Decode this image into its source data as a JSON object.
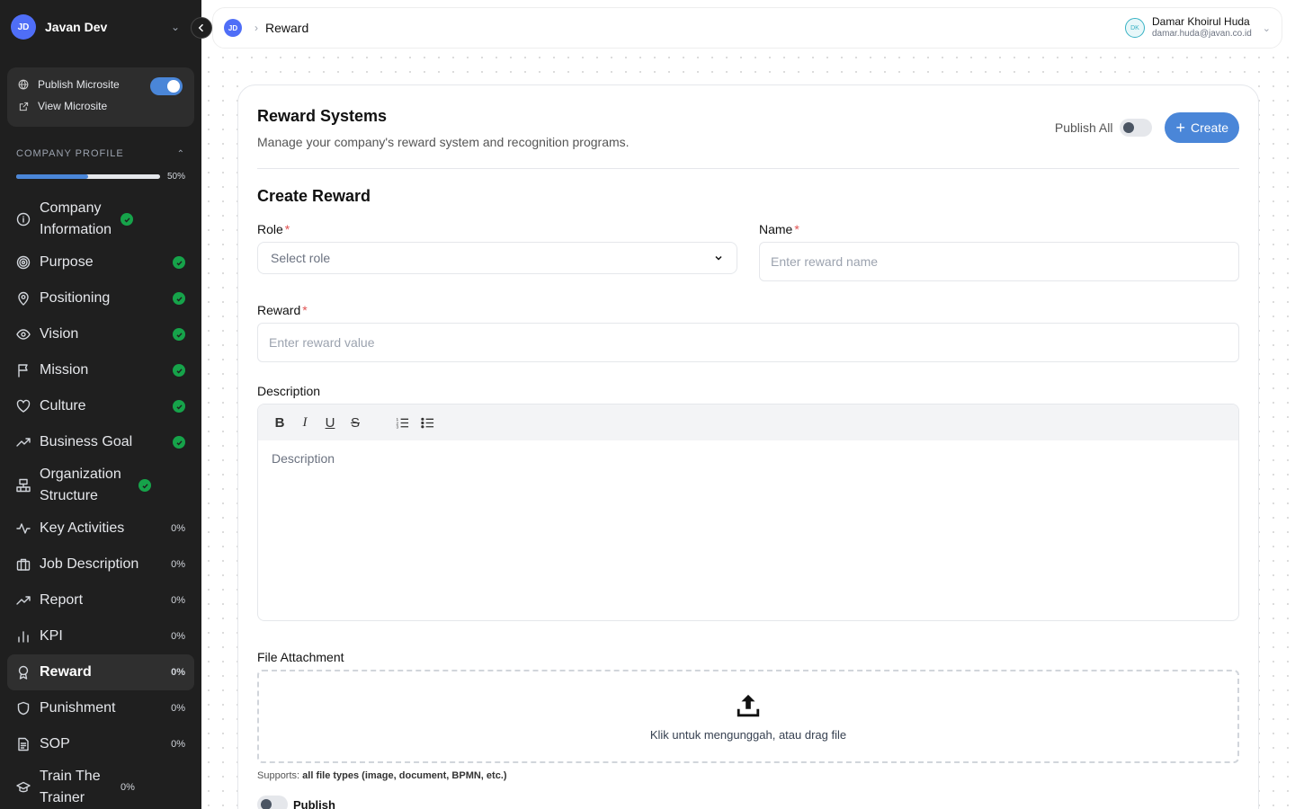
{
  "workspace": {
    "initials": "JD",
    "name": "Javan Dev"
  },
  "microsite": {
    "publish_label": "Publish Microsite",
    "view_label": "View Microsite",
    "published": true
  },
  "company_profile": {
    "heading": "COMPANY PROFILE",
    "progress_percent": 50,
    "progress_label": "50%",
    "items": [
      {
        "label": "Company Information",
        "icon": "info-icon",
        "status": "done"
      },
      {
        "label": "Purpose",
        "icon": "target-icon",
        "status": "done"
      },
      {
        "label": "Positioning",
        "icon": "location-pin-icon",
        "status": "done"
      },
      {
        "label": "Vision",
        "icon": "eye-icon",
        "status": "done"
      },
      {
        "label": "Mission",
        "icon": "flag-icon",
        "status": "done"
      },
      {
        "label": "Culture",
        "icon": "heart-icon",
        "status": "done"
      },
      {
        "label": "Business Goal",
        "icon": "trending-up-icon",
        "status": "done"
      },
      {
        "label": "Organization Structure",
        "icon": "org-structure-icon",
        "status": "done"
      },
      {
        "label": "Key Activities",
        "icon": "activity-icon",
        "status": "0%"
      },
      {
        "label": "Job Description",
        "icon": "briefcase-icon",
        "status": "0%"
      },
      {
        "label": "Report",
        "icon": "trending-up-icon",
        "status": "0%"
      },
      {
        "label": "KPI",
        "icon": "bar-chart-icon",
        "status": "0%"
      },
      {
        "label": "Reward",
        "icon": "award-icon",
        "status": "0%"
      },
      {
        "label": "Punishment",
        "icon": "shield-icon",
        "status": "0%"
      },
      {
        "label": "SOP",
        "icon": "document-icon",
        "status": "0%"
      },
      {
        "label": "Train The Trainer",
        "icon": "graduation-cap-icon",
        "status": "0%"
      }
    ]
  },
  "topbar": {
    "avatar": "JD",
    "breadcrumb": "Reward",
    "user": {
      "initials": "DK",
      "name": "Damar Khoirul Huda",
      "email": "damar.huda@javan.co.id"
    }
  },
  "page": {
    "title": "Reward Systems",
    "subtitle": "Manage your company's reward system and recognition programs.",
    "publish_all_label": "Publish All",
    "create_label": "Create"
  },
  "form": {
    "title": "Create Reward",
    "role": {
      "label": "Role",
      "placeholder": "Select role"
    },
    "name": {
      "label": "Name",
      "placeholder": "Enter reward name"
    },
    "reward": {
      "label": "Reward",
      "placeholder": "Enter reward value"
    },
    "description": {
      "label": "Description",
      "placeholder": "Description"
    },
    "attachment": {
      "label": "File Attachment",
      "dropzone_text": "Klik untuk mengunggah, atau drag file",
      "supports_prefix": "Supports:",
      "supports_types": "all file types (image, document, BPMN, etc.)"
    },
    "publish_label": "Publish"
  },
  "colors": {
    "accent": "#4a86d8",
    "success": "#16a34a",
    "sidebar_bg": "#1f1f1f",
    "required": "#e05252"
  }
}
